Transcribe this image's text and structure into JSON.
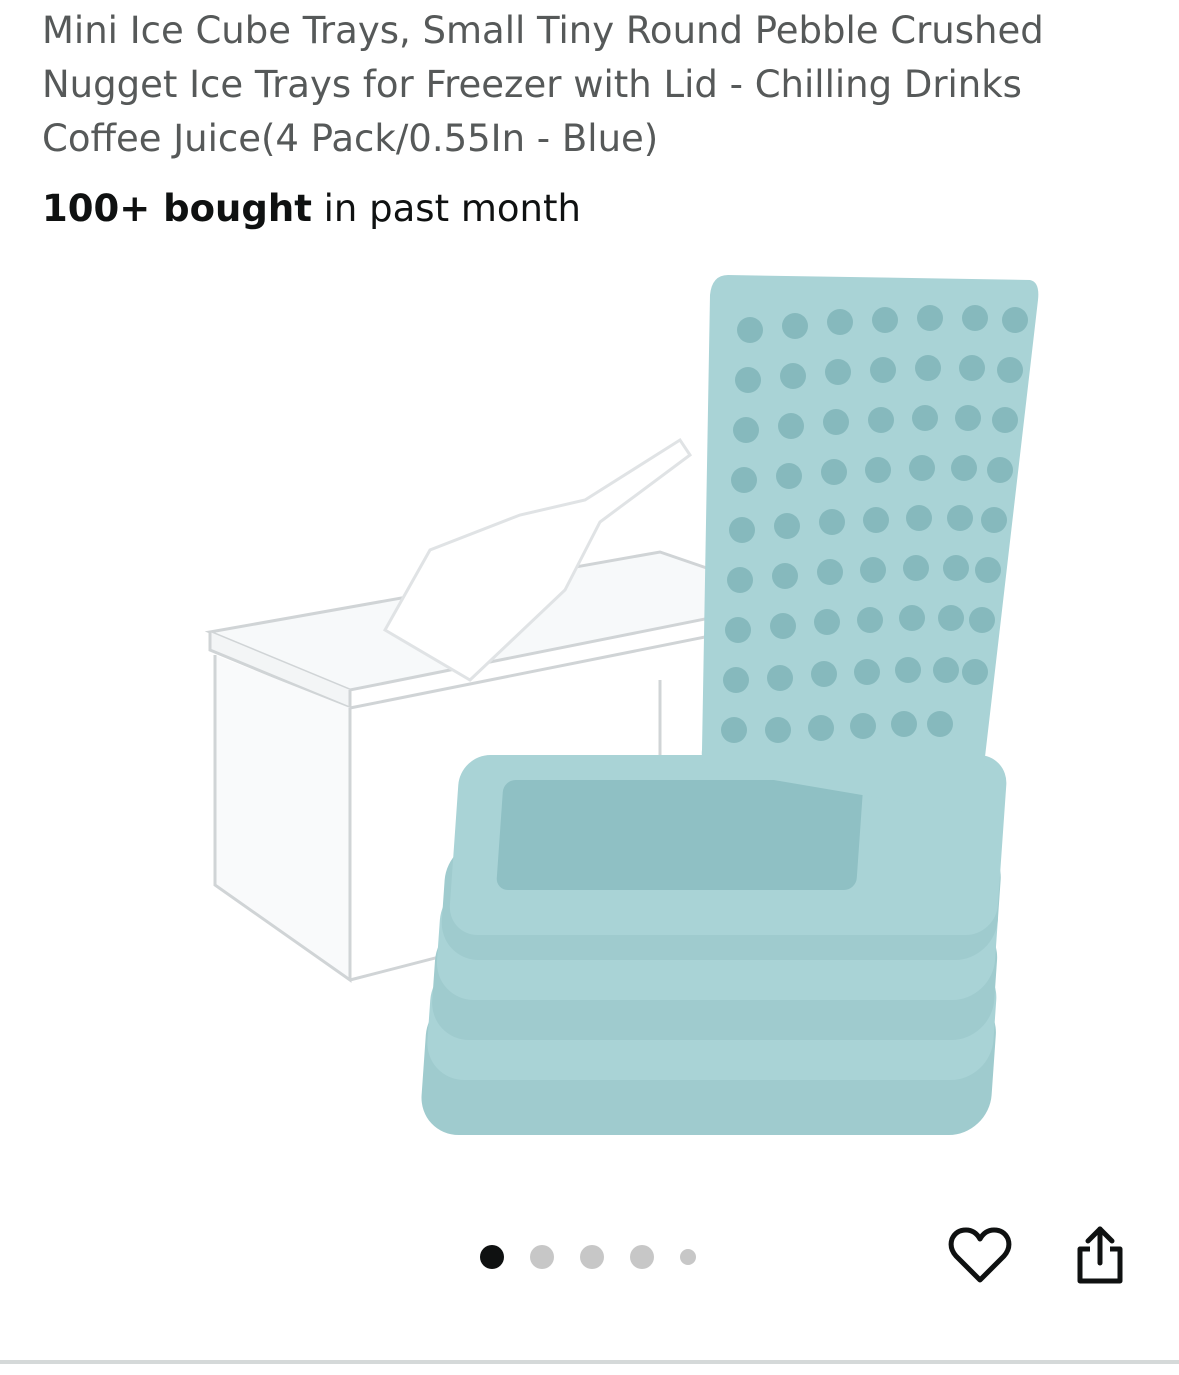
{
  "product": {
    "title": "Mini Ice Cube Trays, Small Tiny Round Pebble Crushed Nugget Ice Trays for Freezer with Lid - Chilling Drinks Coffee Juice(4 Pack/0.55In - Blue)",
    "bought_count": "100+ bought",
    "bought_suffix": " in past month"
  },
  "gallery": {
    "image_alt": "Product image: clear ice bin with scoop and stack of blue mini ice cube trays",
    "dots_total": 5,
    "active_index": 0
  },
  "actions": {
    "wishlist_icon": "heart-outline-icon",
    "share_icon": "share-icon"
  },
  "colors": {
    "tray": "#a9d3d6",
    "tray_dark": "#86b9bd",
    "text_title": "#565959",
    "text_main": "#0f1111"
  }
}
